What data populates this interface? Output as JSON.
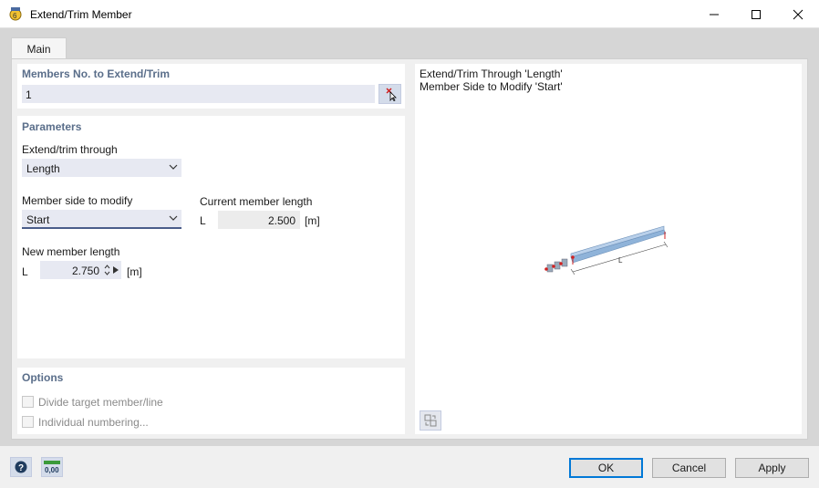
{
  "window": {
    "title": "Extend/Trim Member"
  },
  "tabs": [
    {
      "label": "Main"
    }
  ],
  "members": {
    "title": "Members No. to Extend/Trim",
    "value": "1"
  },
  "parameters": {
    "title": "Parameters",
    "through_label": "Extend/trim through",
    "through_value": "Length",
    "side_label": "Member side to modify",
    "side_value": "Start",
    "current_label": "Current member length",
    "current_symbol": "L",
    "current_value": "2.500",
    "current_unit": "[m]",
    "new_label": "New member length",
    "new_symbol": "L",
    "new_value": "2.750",
    "new_unit": "[m]"
  },
  "options": {
    "title": "Options",
    "divide_label": "Divide target member/line",
    "individual_label": "Individual numbering...",
    "divide_checked": false,
    "individual_checked": false
  },
  "preview": {
    "line1": "Extend/Trim Through 'Length'",
    "line2": "Member Side to Modify 'Start'",
    "dim_label": "L"
  },
  "buttons": {
    "ok": "OK",
    "cancel": "Cancel",
    "apply": "Apply",
    "units_icon_text": "0,00"
  },
  "colors": {
    "accent": "#0078d7",
    "section_title": "#5a6e8a",
    "field_bg": "#e7e9f2",
    "member_blue": "#8fb3d9",
    "marker_red": "#d02020"
  }
}
